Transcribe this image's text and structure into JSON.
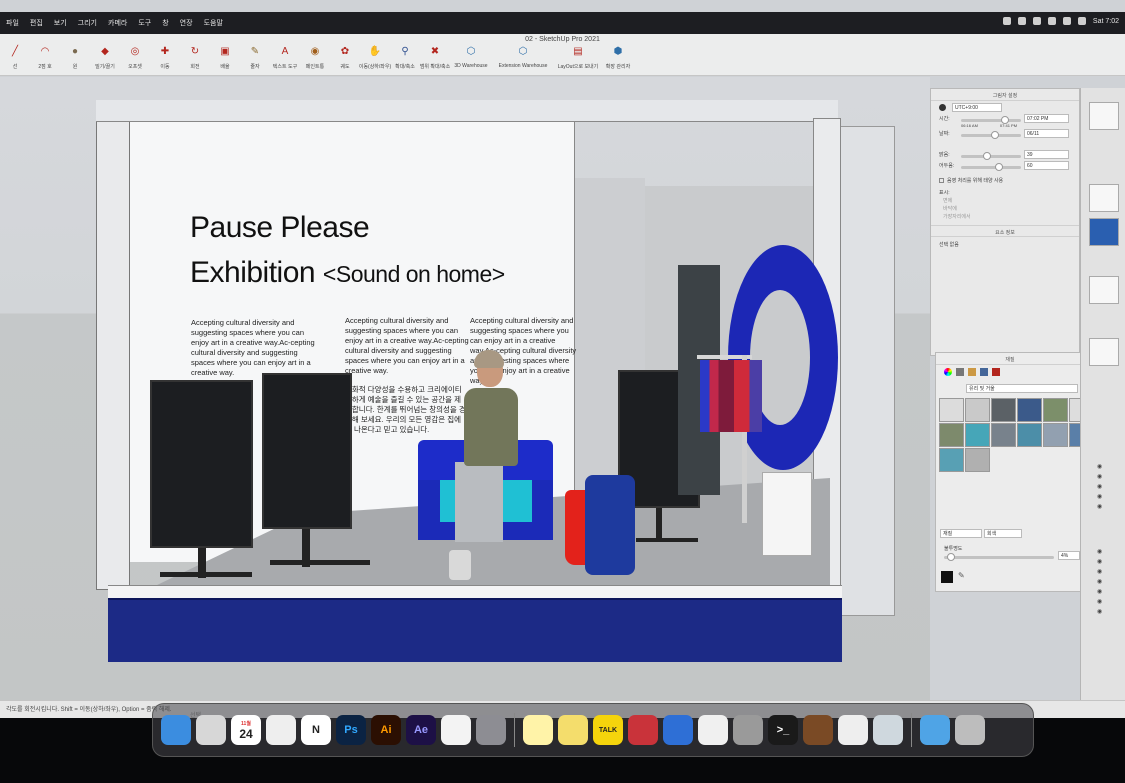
{
  "window": {
    "title": "02 - SketchUp Pro 2021"
  },
  "menubar": {
    "items": [
      "파일",
      "편집",
      "보기",
      "그리기",
      "카메라",
      "도구",
      "창",
      "연장",
      "도움말"
    ],
    "clock": "Sat 7:02"
  },
  "toolbar": {
    "tools": [
      {
        "label": "선",
        "icon": "pencil-icon"
      },
      {
        "label": "2점 호",
        "icon": "arc-icon"
      },
      {
        "label": "원",
        "icon": "circle-icon"
      },
      {
        "label": "밀기/끌기",
        "icon": "push-pull-icon"
      },
      {
        "label": "오프셋",
        "icon": "offset-icon"
      },
      {
        "label": "이동",
        "icon": "move-icon"
      },
      {
        "label": "회전",
        "icon": "rotate-icon"
      },
      {
        "label": "배율",
        "icon": "scale-icon"
      },
      {
        "label": "줄자",
        "icon": "tape-icon"
      },
      {
        "label": "텍스트 도구",
        "icon": "text-tool-icon"
      },
      {
        "label": "페인트통",
        "icon": "paint-bucket-icon"
      },
      {
        "label": "궤도",
        "icon": "orbit-icon"
      },
      {
        "label": "이동(상하/좌우)",
        "icon": "pan-icon"
      },
      {
        "label": "확대/축소",
        "icon": "zoom-icon"
      },
      {
        "label": "범위 확대/축소",
        "icon": "zoom-extents-icon"
      },
      {
        "label": "3D Warehouse",
        "icon": "warehouse-icon"
      },
      {
        "label": "Extension Warehouse",
        "icon": "extension-icon"
      },
      {
        "label": "LayOut으로 보내기",
        "icon": "layout-icon"
      },
      {
        "label": "확장 관리자",
        "icon": "extension-manager-icon"
      }
    ]
  },
  "artwork": {
    "title_line1": "Pause Please",
    "title_line2": "Exhibition",
    "title_line2_sub": "<Sound on home>",
    "col1_en": "Accepting cultural diversity and suggesting spaces where you can enjoy art in a creative way.Ac-cepting cultural diversity and suggesting spaces where you can enjoy art in a creative way.",
    "col2_en": "Accepting cultural diversity and suggesting spaces where you can enjoy art in a creative way.Ac-cepting cultural diversity and suggesting spaces where you can enjoy art in a creative way.",
    "col2_ko": "문화적 다양성을 수용하고 크리에이티브하게 예술을 즐길 수 있는 공간을 제안합니다. 한계를 뛰어넘는 창의성을 경험해 보세요. 우리의 모든 영감은 집에서 나온다고 믿고 있습니다.",
    "col3_en": "Accepting cultural diversity and suggesting spaces where you can enjoy art in a creative way.Ac-cepting cultural diversity and suggesting spaces where you can enjoy art in a creative way."
  },
  "shadow_panel": {
    "title": "그림자 설정",
    "utc": "UTC+9:00",
    "time_label": "시간:",
    "time_value": "07:02 PM",
    "time_min": "06:16 AM",
    "time_max": "07:41 PM",
    "date_label": "날짜:",
    "date_value": "06/11",
    "light_label": "밝음:",
    "light_value": "39",
    "dark_label": "어두움:",
    "dark_value": "60",
    "sun_shading": "음영 처리를 위해 태양 사용",
    "display_label": "표시:",
    "display_items": [
      "면에",
      "바닥에",
      "가장자리에서"
    ]
  },
  "entity_panel": {
    "title": "요소 정보",
    "selection": "선택 없음"
  },
  "materials_panel": {
    "title": "재질",
    "category": "유리 및 거울",
    "edit_tab": "재질",
    "color_tab": "회색",
    "opacity_label": "불투명도",
    "opacity_value": "4%"
  },
  "statusbar": {
    "hint": "각도를 회전시킵니다. Shift = 이동(상하/좌우), Option = 줌력 해제.",
    "measure_label": "선택"
  },
  "dock": {
    "calendar_month": "11월",
    "calendar_day": "24",
    "apps": [
      "finder-icon",
      "launchpad-icon",
      "calendar-icon",
      "chrome-icon",
      "notion-icon",
      "photoshop-icon",
      "illustrator-icon",
      "after-effects-icon",
      "sketchup-icon",
      "system-prefs-icon",
      "notes-icon",
      "stickies-icon",
      "kakaotalk-icon",
      "parallels-icon",
      "windows-icon",
      "keynote-icon",
      "preview-icon",
      "terminal-icon",
      "archive-icon",
      "chrome-2-icon",
      "slides-icon",
      "folder-icon",
      "trash-icon"
    ]
  }
}
